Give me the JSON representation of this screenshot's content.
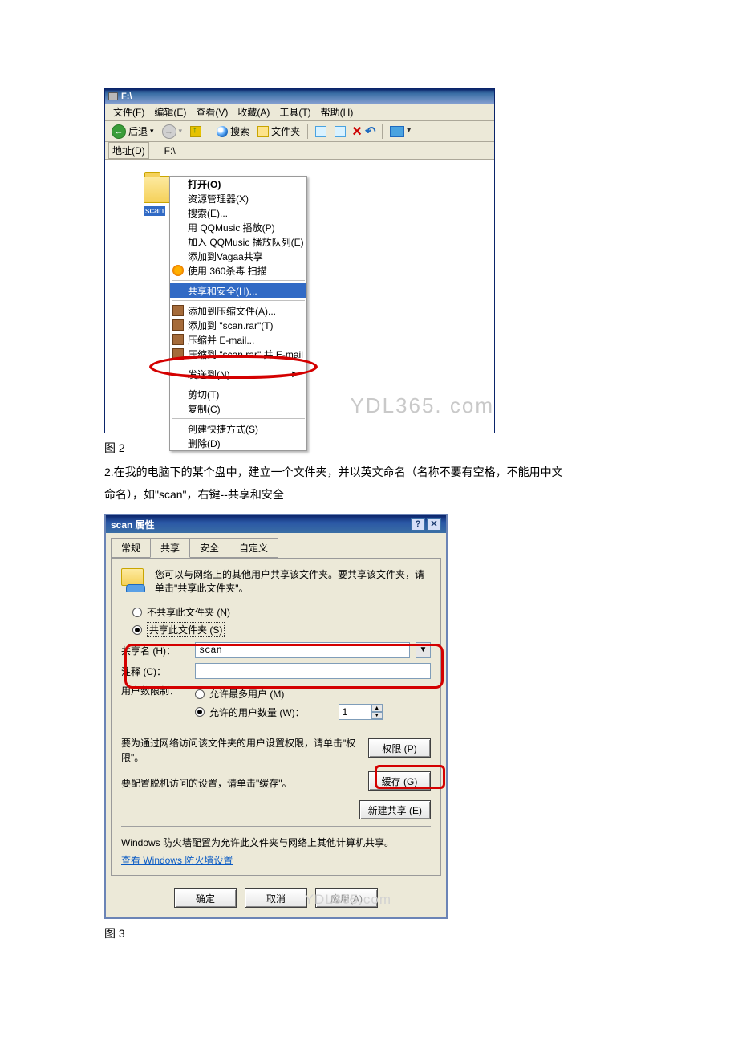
{
  "figure1": {
    "title": "F:\\",
    "menubar": [
      "文件(F)",
      "编辑(E)",
      "查看(V)",
      "收藏(A)",
      "工具(T)",
      "帮助(H)"
    ],
    "toolbar": {
      "back": "后退",
      "search": "搜索",
      "folders": "文件夹"
    },
    "addressbar": {
      "label": "地址(D)",
      "value": "F:\\"
    },
    "folder": {
      "name": "scan"
    },
    "context_menu": {
      "open": "打开(O)",
      "explorer": "资源管理器(X)",
      "search": "搜索(E)...",
      "qqmusic_play": "用 QQMusic 播放(P)",
      "qqmusic_queue": "加入 QQMusic 播放队列(E)",
      "vagaa": "添加到Vagaa共享",
      "av_scan": "使用 360杀毒 扫描",
      "share_sec": "共享和安全(H)...",
      "rar_add": "添加到压缩文件(A)...",
      "rar_add_named": "添加到 \"scan.rar\"(T)",
      "rar_email": "压缩并 E-mail...",
      "rar_email_named": "压缩到 \"scan.rar\" 并 E-mail",
      "sendto": "发送到(N)",
      "cut": "剪切(T)",
      "copy": "复制(C)",
      "shortcut": "创建快捷方式(S)",
      "delete": "删除(D)"
    },
    "watermark": "YDL365. com"
  },
  "captions": {
    "fig2": "图 2",
    "body_line1": "2.在我的电脑下的某个盘中，建立一个文件夹，并以英文命名（名称不要有空格，不能用中文",
    "body_line2": "命名），如\"scan\"，右键--共享和安全",
    "fig3": "图 3"
  },
  "figure2": {
    "title": "scan 属性",
    "tabs": [
      "常规",
      "共享",
      "安全",
      "自定义"
    ],
    "active_tab_index": 1,
    "info_text": "您可以与网络上的其他用户共享该文件夹。要共享该文件夹，请单击\"共享此文件夹\"。",
    "radio_noshare": "不共享此文件夹 (N)",
    "radio_share": "共享此文件夹 (S)",
    "share_name_label": "共享名 (H)：",
    "share_name_value": "scan",
    "comment_label": "注释 (C)：",
    "user_limit_label": "用户数限制：",
    "radio_maxusers": "允许最多用户 (M)",
    "radio_usercount": "允许的用户数量 (W)：",
    "user_count_value": "1",
    "perm_desc": "要为通过网络访问该文件夹的用户设置权限，请单击\"权限\"。",
    "perm_button": "权限 (P)",
    "cache_desc": "要配置脱机访问的设置，请单击\"缓存\"。",
    "cache_button": "缓存 (G)",
    "newshare_button": "新建共享 (E)",
    "firewall_text": "Windows 防火墙配置为允许此文件夹与网络上其他计算机共享。",
    "firewall_link": "查看 Windows 防火墙设置",
    "buttons": {
      "ok": "确定",
      "cancel": "取消",
      "apply": "应用(A)"
    },
    "watermark": "YDL365.com"
  }
}
